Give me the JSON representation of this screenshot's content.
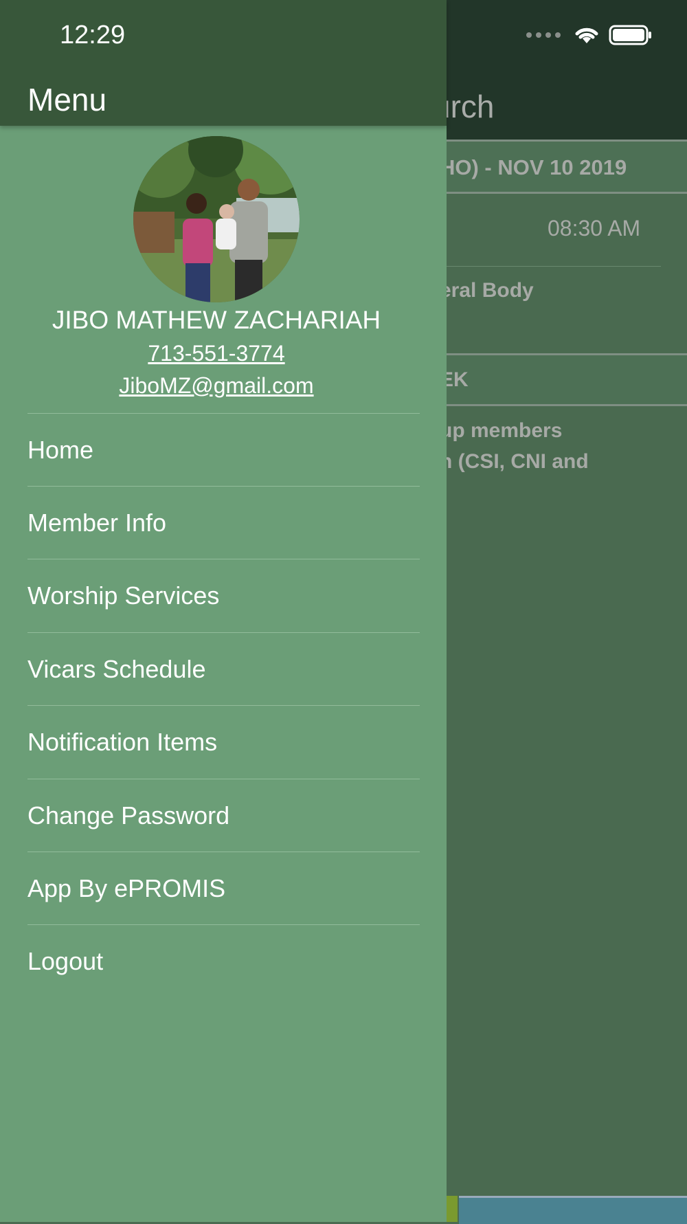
{
  "status_bar": {
    "time": "12:29"
  },
  "background_page": {
    "title_fragment": "urch",
    "section_header": "HO) - NOV 10 2019",
    "time_value": "08:30 AM",
    "item_text": "eral Body",
    "section_header_2": "EK",
    "desc_line_1": "up members",
    "desc_line_2": "n (CSI, CNI and"
  },
  "drawer": {
    "title": "Menu",
    "profile": {
      "name": "JIBO MATHEW ZACHARIAH",
      "phone": "713-551-3774",
      "email": "JiboMZ@gmail.com"
    },
    "items": [
      {
        "label": "Home"
      },
      {
        "label": "Member Info"
      },
      {
        "label": "Worship Services"
      },
      {
        "label": "Vicars Schedule"
      },
      {
        "label": "Notification Items"
      },
      {
        "label": "Change Password"
      },
      {
        "label": "App By ePROMIS"
      },
      {
        "label": "Logout"
      }
    ]
  },
  "colors": {
    "drawer_bg": "#6b9e77",
    "drawer_header": "#38573a",
    "page_header": "#223629",
    "page_bg": "#4a6a50"
  }
}
